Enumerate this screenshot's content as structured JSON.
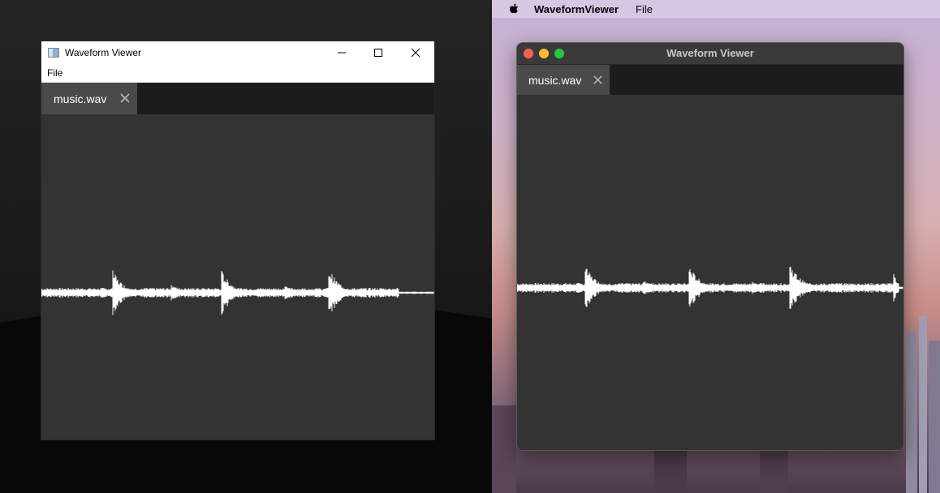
{
  "windows_window": {
    "title": "Waveform Viewer",
    "menu": [
      "File"
    ],
    "tab": {
      "label": "music.wav"
    },
    "waveform_color": "#ffffff",
    "background_color": "#333333"
  },
  "mac_window": {
    "menubar": {
      "app_name": "WaveformViewer",
      "menu": [
        "File"
      ]
    },
    "title": "Waveform Viewer",
    "tab": {
      "label": "music.wav"
    },
    "traffic_light_colors": {
      "close": "#ff5f57",
      "minimize": "#febc2e",
      "zoom": "#28c840"
    },
    "waveform_color": "#ffffff"
  },
  "icons": [
    "app-icon",
    "minimize-icon",
    "maximize-icon",
    "close-icon",
    "tab-close-icon",
    "apple-icon"
  ]
}
